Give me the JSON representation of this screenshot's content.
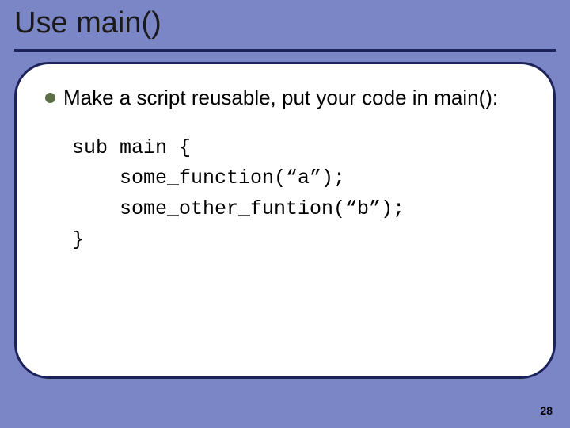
{
  "title": "Use main()",
  "bullet": {
    "text": "Make a script reusable, put your code in main():"
  },
  "code": {
    "lines": "sub main {\n    some_function(“a”);\n    some_other_funtion(“b”);\n}"
  },
  "slide_number": "28"
}
